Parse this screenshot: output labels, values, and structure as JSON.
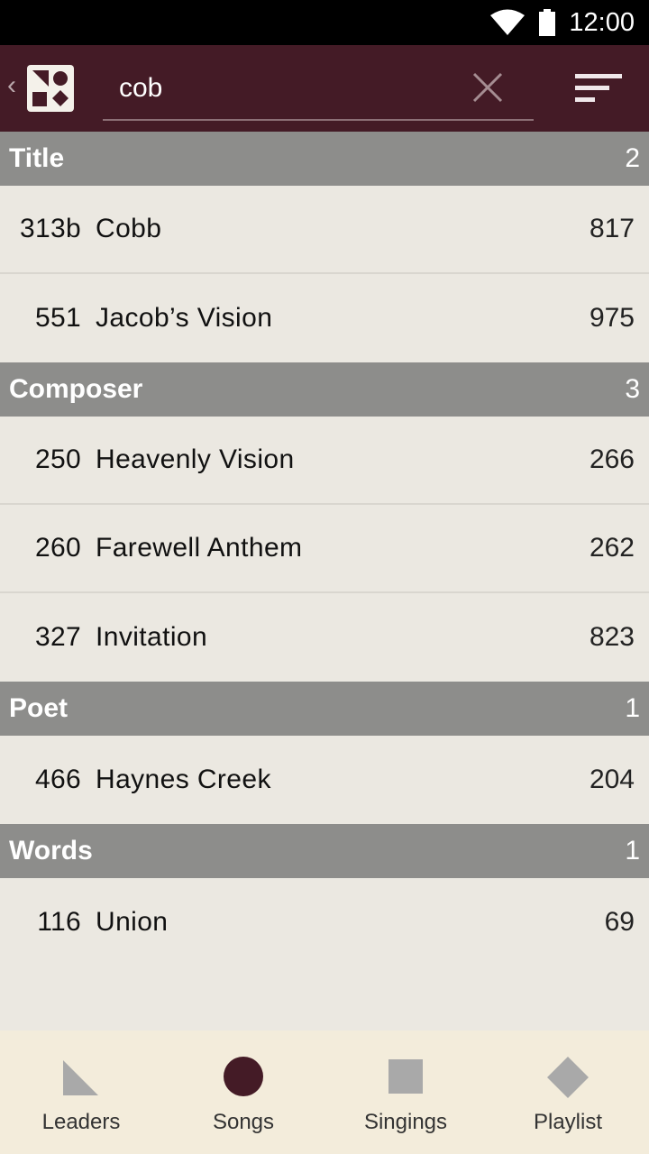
{
  "status_bar": {
    "time": "12:00",
    "icons": [
      "wifi-icon",
      "battery-icon"
    ]
  },
  "app_bar": {
    "search": {
      "value": "cob",
      "placeholder": ""
    },
    "icons": [
      "back-chevron-icon",
      "app-logo-icon",
      "clear-icon",
      "sort-icon"
    ],
    "back_glyph": "‹"
  },
  "colors": {
    "app_bar_bg": "#441b26",
    "section_header_bg": "#8d8d8b",
    "list_bg": "#ebe8e1",
    "bottom_nav_bg": "#f3ecdb",
    "active_nav_icon": "#441b26",
    "inactive_nav_icon": "#a9a9a9"
  },
  "sections": [
    {
      "label": "Title",
      "count": "2",
      "rows": [
        {
          "number": "313b",
          "title": "Cobb",
          "count": "817"
        },
        {
          "number": "551",
          "title": "Jacob’s Vision",
          "count": "975"
        }
      ]
    },
    {
      "label": "Composer",
      "count": "3",
      "rows": [
        {
          "number": "250",
          "title": "Heavenly Vision",
          "count": "266"
        },
        {
          "number": "260",
          "title": "Farewell Anthem",
          "count": "262"
        },
        {
          "number": "327",
          "title": "Invitation",
          "count": "823"
        }
      ]
    },
    {
      "label": "Poet",
      "count": "1",
      "rows": [
        {
          "number": "466",
          "title": "Haynes Creek",
          "count": "204"
        }
      ]
    },
    {
      "label": "Words",
      "count": "1",
      "rows": [
        {
          "number": "116",
          "title": "Union",
          "count": "69"
        }
      ]
    }
  ],
  "bottom_nav": {
    "items": [
      {
        "label": "Leaders",
        "icon": "triangle-icon",
        "active": false
      },
      {
        "label": "Songs",
        "icon": "circle-icon",
        "active": true
      },
      {
        "label": "Singings",
        "icon": "square-icon",
        "active": false
      },
      {
        "label": "Playlist",
        "icon": "diamond-icon",
        "active": false
      }
    ]
  }
}
